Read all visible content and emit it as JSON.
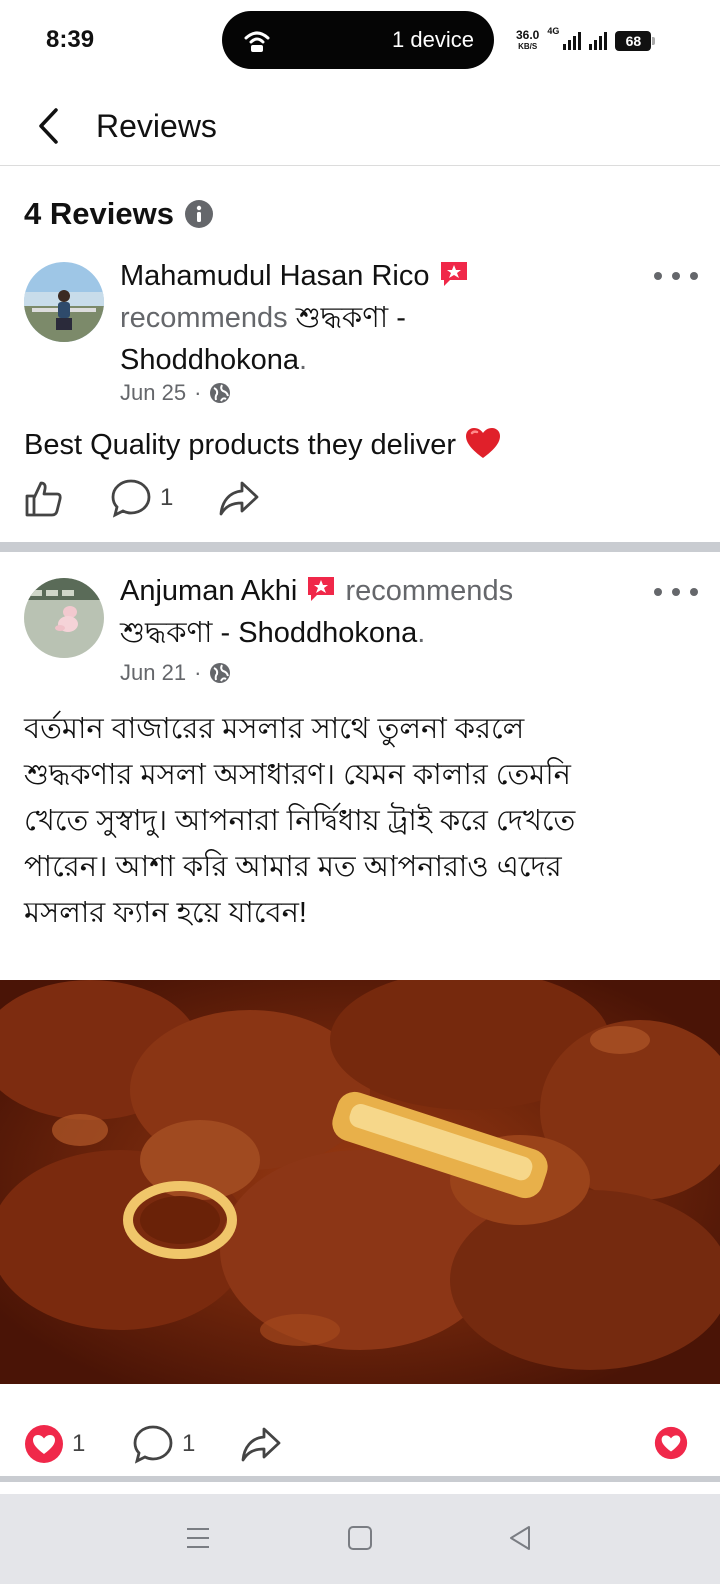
{
  "status_bar": {
    "time": "8:39",
    "hotspot_label": "1 device",
    "speed_value": "36.0",
    "speed_unit": "KB/S",
    "network": "4G",
    "battery": "68"
  },
  "header": {
    "title": "Reviews"
  },
  "reviews_section": {
    "count_title": "4 Reviews"
  },
  "reviews": [
    {
      "author": "Mahamudul Hasan Rico",
      "verb": "recommends",
      "page_bn": "শুদ্ধকণা -",
      "page_en": "Shoddhokona",
      "date": "Jun 25",
      "text": "Best Quality products they deliver",
      "comments": "1"
    },
    {
      "author": "Anjuman Akhi",
      "verb": "recommends",
      "page_bn": "শুদ্ধকণা - Shoddhokona",
      "date": "Jun 21",
      "text_lines": [
        "বর্তমান বাজারের মসলার সাথে তুলনা করলে",
        "শুদ্ধকণার মসলা অসাধারণ। যেমন কালার তেমনি",
        "খেতে সুস্বাদু।  আপনারা নির্দ্বিধায় ট্রাই করে দেখতে",
        "পারেন। আশা করি আমার মত আপনারাও এদের",
        "মসলার ফ্যান হয়ে যাবেন!"
      ],
      "likes": "1",
      "comments": "1"
    }
  ],
  "colors": {
    "muted": "#65676b",
    "like_red": "#f0284a",
    "divider": "#c9ccd1"
  }
}
